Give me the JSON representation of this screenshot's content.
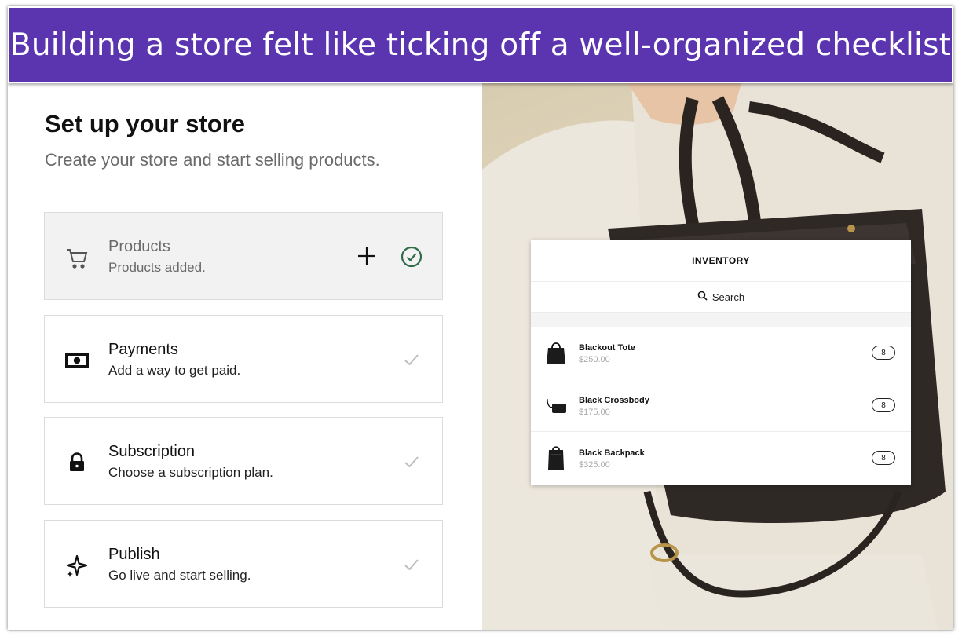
{
  "banner": {
    "text": "Building a store felt like ticking off a well-organized checklist"
  },
  "setup": {
    "title": "Set up your store",
    "subtitle": "Create your store and start selling products.",
    "steps": [
      {
        "name": "Products",
        "description": "Products added.",
        "icon": "cart-icon",
        "completed": true
      },
      {
        "name": "Payments",
        "description": "Add a way to get paid.",
        "icon": "cash-icon",
        "completed": false
      },
      {
        "name": "Subscription",
        "description": "Choose a subscription plan.",
        "icon": "lock-icon",
        "completed": false
      },
      {
        "name": "Publish",
        "description": "Go live and start selling.",
        "icon": "sparkle-icon",
        "completed": false
      }
    ]
  },
  "inventory": {
    "header": "INVENTORY",
    "search_label": "Search",
    "items": [
      {
        "name": "Blackout Tote",
        "price": "$250.00",
        "quantity": "8"
      },
      {
        "name": "Black Crossbody",
        "price": "$175.00",
        "quantity": "8"
      },
      {
        "name": "Black Backpack",
        "price": "$325.00",
        "quantity": "8"
      }
    ]
  },
  "colors": {
    "banner": "#5b34b0",
    "done_check": "#2e6b46",
    "muted_check": "#bdbdbd"
  }
}
